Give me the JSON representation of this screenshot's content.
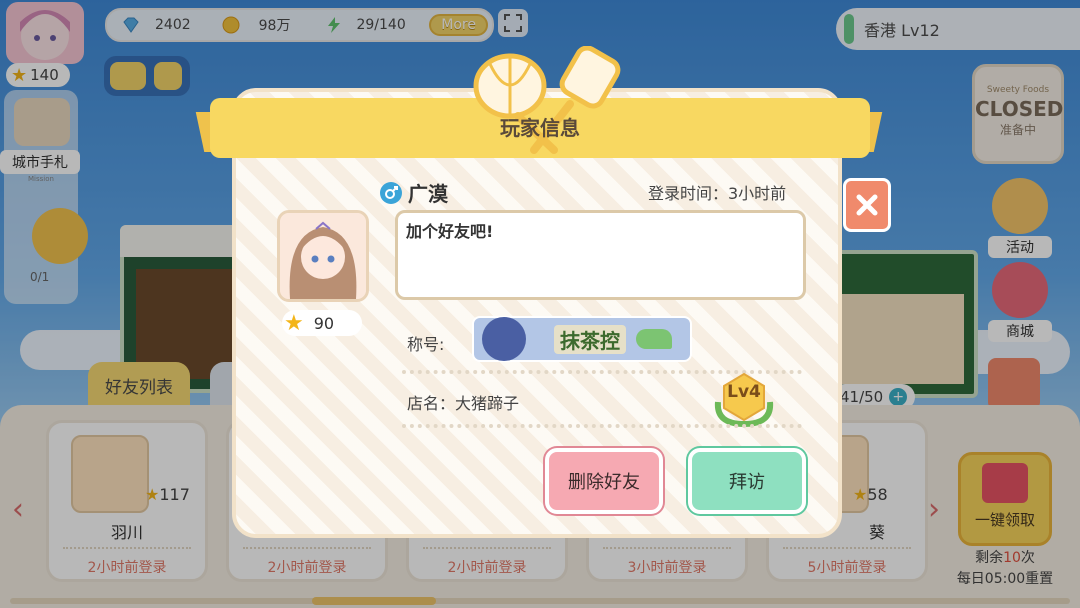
{
  "resources": {
    "gems": "2402",
    "coins": "98万",
    "energy": "29/140",
    "more_label": "More"
  },
  "region": {
    "label": "香港 Lv12"
  },
  "left_panel": {
    "stars": "140",
    "city_notes_label": "城市手札",
    "mission_label": "Mission",
    "food_count": "0/1"
  },
  "right_panel": {
    "sign_top": "Sweety Foods",
    "closed_label": "CLOSED",
    "preparing_label": "准备中",
    "activity_label": "活动",
    "mall_label": "商城"
  },
  "friends": {
    "tab_label": "好友列表",
    "count": "41/50",
    "cards": [
      {
        "name": "羽川",
        "stars": "117",
        "login": "2小时前登录"
      },
      {
        "name": "",
        "stars": "",
        "login": "2小时前登录"
      },
      {
        "name": "",
        "stars": "",
        "login": "2小时前登录"
      },
      {
        "name": "",
        "stars": "",
        "login": "3小时前登录"
      },
      {
        "name": "葵",
        "stars": "58",
        "login": "5小时前登录"
      }
    ],
    "collect_all_label": "一键领取",
    "remaining_prefix": "剩余",
    "remaining_count": "10",
    "remaining_suffix": "次",
    "reset_label": "每日05:00重置"
  },
  "dialog": {
    "title": "玩家信息",
    "player_name": "广漠",
    "login_time": "登录时间：3小时前",
    "message": "加个好友吧!",
    "stars": "90",
    "title_label": "称号:",
    "title_badge": "抹茶控",
    "shop_label": "店名：大猪蹄子",
    "level": "Lv4",
    "delete_button": "删除好友",
    "visit_button": "拜访"
  },
  "colors": {
    "ribbon": "#f8d861",
    "delete": "#f6a9b2",
    "visit": "#8ee0c0",
    "close": "#f08a6c"
  }
}
